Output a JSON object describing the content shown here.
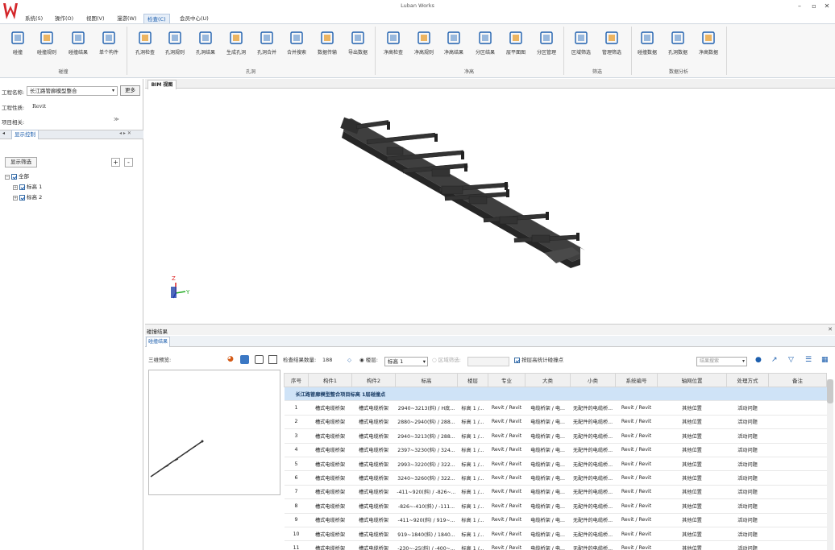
{
  "app": {
    "title": "Luban Works"
  },
  "menu": [
    "系统(S)",
    "操作(O)",
    "视图(V)",
    "漫游(W)",
    "检查(C)",
    "会员中心(U)"
  ],
  "menu_active_index": 4,
  "ribbon": {
    "buttons": [
      "碰撞",
      "碰撞规则",
      "碰撞结果",
      "单个构件",
      "孔洞检查",
      "孔洞规则",
      "孔洞结果",
      "生成孔洞",
      "孔洞合并",
      "合并搜索",
      "数据传输",
      "导出数据",
      "净高检查",
      "净高规则",
      "净高结果",
      "分区结果",
      "层平面图",
      "分区管理",
      "区域筛选",
      "管理筛选",
      "碰撞数据",
      "孔洞数据",
      "净高数据"
    ],
    "groups": [
      "碰撞",
      "孔洞",
      "净高",
      "筛选",
      "数据分析"
    ]
  },
  "left_panel": {
    "project_label": "工程名称:",
    "project_value": "长江路管廊模型整合",
    "more_button": "更多",
    "type_label": "工程性质:",
    "type_value": "Revit",
    "related_label": "项目相关:",
    "display_tab": "显示控制",
    "filter_button": "显示筛选",
    "plus": "+",
    "minus": "-",
    "tree": [
      {
        "label": "全部",
        "level": 0
      },
      {
        "label": "标高 1",
        "level": 1
      },
      {
        "label": "标高 2",
        "level": 1
      }
    ]
  },
  "viewport": {
    "tab": "BIM 视图",
    "axis_z": "Z",
    "axis_y": "Y"
  },
  "bottom": {
    "title": "碰撞结果",
    "tab": "碰撞结果",
    "preview_label": "三维预览:",
    "count_label": "检查结果数量:",
    "count_value": "188",
    "floor_label": "楼层:",
    "floor_value": "标高 1",
    "region_label": "区域筛选:",
    "check_label": "按层高统计碰撞点",
    "search_placeholder": "结果搜索"
  },
  "table": {
    "columns": [
      "序号",
      "构件1",
      "构件2",
      "标高",
      "楼层",
      "专业",
      "大类",
      "小类",
      "系统编号",
      "轴网位置",
      "处理方式",
      "备注"
    ],
    "group_title": "长江路管廊模型整合项目标高 1层碰撞点",
    "rows": [
      [
        "1",
        "槽式电缆桥架",
        "槽式电缆桥架",
        "2940~3213(斜) / H底...",
        "标高 1 /...",
        "Revit / Revit",
        "电缆桥架 / 电...",
        "无配件的电缆桥...",
        "Revit / Revit",
        "其他位置",
        "活动问题",
        ""
      ],
      [
        "2",
        "槽式电缆桥架",
        "槽式电缆桥架",
        "2880~2940(斜) / 288...",
        "标高 1 /...",
        "Revit / Revit",
        "电缆桥架 / 电...",
        "无配件的电缆桥...",
        "Revit / Revit",
        "其他位置",
        "活动问题",
        ""
      ],
      [
        "3",
        "槽式电缆桥架",
        "槽式电缆桥架",
        "2940~3213(斜) / 288...",
        "标高 1 /...",
        "Revit / Revit",
        "电缆桥架 / 电...",
        "无配件的电缆桥...",
        "Revit / Revit",
        "其他位置",
        "活动问题",
        ""
      ],
      [
        "4",
        "槽式电缆桥架",
        "槽式电缆桥架",
        "2397~3230(斜) / 324...",
        "标高 1 /...",
        "Revit / Revit",
        "电缆桥架 / 电...",
        "无配件的电缆桥...",
        "Revit / Revit",
        "其他位置",
        "活动问题",
        ""
      ],
      [
        "5",
        "槽式电缆桥架",
        "槽式电缆桥架",
        "2993~3220(斜) / 322...",
        "标高 1 /...",
        "Revit / Revit",
        "电缆桥架 / 电...",
        "无配件的电缆桥...",
        "Revit / Revit",
        "其他位置",
        "活动问题",
        ""
      ],
      [
        "6",
        "槽式电缆桥架",
        "槽式电缆桥架",
        "3240~3260(斜) / 322...",
        "标高 1 /...",
        "Revit / Revit",
        "电缆桥架 / 电...",
        "无配件的电缆桥...",
        "Revit / Revit",
        "其他位置",
        "活动问题",
        ""
      ],
      [
        "7",
        "槽式电缆桥架",
        "槽式电缆桥架",
        "-411~920(斜) / -826~...",
        "标高 1 /...",
        "Revit / Revit",
        "电缆桥架 / 电...",
        "无配件的电缆桥...",
        "Revit / Revit",
        "其他位置",
        "活动问题",
        ""
      ],
      [
        "8",
        "槽式电缆桥架",
        "槽式电缆桥架",
        "-826~-410(斜) / -111...",
        "标高 1 /...",
        "Revit / Revit",
        "电缆桥架 / 电...",
        "无配件的电缆桥...",
        "Revit / Revit",
        "其他位置",
        "活动问题",
        ""
      ],
      [
        "9",
        "槽式电缆桥架",
        "槽式电缆桥架",
        "-411~920(斜) / 919~...",
        "标高 1 /...",
        "Revit / Revit",
        "电缆桥架 / 电...",
        "无配件的电缆桥...",
        "Revit / Revit",
        "其他位置",
        "活动问题",
        ""
      ],
      [
        "10",
        "槽式电缆桥架",
        "槽式电缆桥架",
        "919~1840(斜) / 1840...",
        "标高 1 /...",
        "Revit / Revit",
        "电缆桥架 / 电...",
        "无配件的电缆桥...",
        "Revit / Revit",
        "其他位置",
        "活动问题",
        ""
      ],
      [
        "11",
        "槽式电缆桥架",
        "槽式电缆桥架",
        "-230~-25(斜) / -400~...",
        "标高 1 /...",
        "Revit / Revit",
        "电缆桥架 / 电...",
        "无配件的电缆桥...",
        "Revit / Revit",
        "其他位置",
        "活动问题",
        ""
      ]
    ]
  },
  "colors": {
    "accent": "#1d5fae",
    "logo": "#d4262a",
    "group_row": "#cfe3f7"
  },
  "icons": [
    "logo-icon",
    "minimize-icon",
    "maximize-icon",
    "close-icon",
    "expand-icon",
    "color-icon",
    "fit-icon",
    "camera-icon",
    "copy-icon",
    "location-icon",
    "export-icon",
    "filter-icon",
    "list-icon",
    "grid-icon"
  ]
}
